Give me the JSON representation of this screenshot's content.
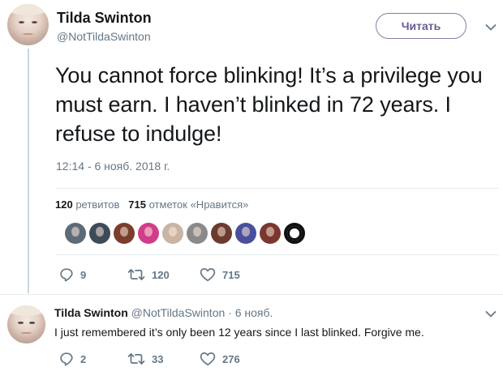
{
  "main_tweet": {
    "author_name": "Tilda Swinton",
    "handle": "@NotTildaSwinton",
    "follow_label": "Читать",
    "text": "You cannot force blinking! It’s a privilege you must earn. I haven’t blinked in 72 years. I refuse to indulge!",
    "timestamp": "12:14 - 6 нояб. 2018 г.",
    "stats": {
      "retweets_count": "120",
      "retweets_label": "ретвитов",
      "likes_count": "715",
      "likes_label": "отметок «Нравится»"
    },
    "likers": [
      {
        "color": "#5d6b78"
      },
      {
        "color": "#3e4b57"
      },
      {
        "color": "#7b3e2c"
      },
      {
        "color": "#d13d8a"
      },
      {
        "color": "#c9b4a5"
      },
      {
        "color": "#8a8a8a"
      },
      {
        "color": "#6a3b2e"
      },
      {
        "color": "#4a4f9c"
      },
      {
        "color": "#7a3730"
      },
      {
        "color": "#111111"
      }
    ],
    "actions": {
      "replies": "9",
      "retweets": "120",
      "likes": "715"
    }
  },
  "reply_tweet": {
    "author_name": "Tilda Swinton",
    "handle": "@NotTildaSwinton",
    "separator": "·",
    "date": "6 нояб.",
    "text": "I just remembered it’s only been 12 years since I last blinked. Forgive me.",
    "actions": {
      "replies": "2",
      "retweets": "33",
      "likes": "276"
    }
  },
  "colors": {
    "accent": "#6b5b93",
    "muted": "#657786",
    "divider": "#e6ecf0"
  }
}
